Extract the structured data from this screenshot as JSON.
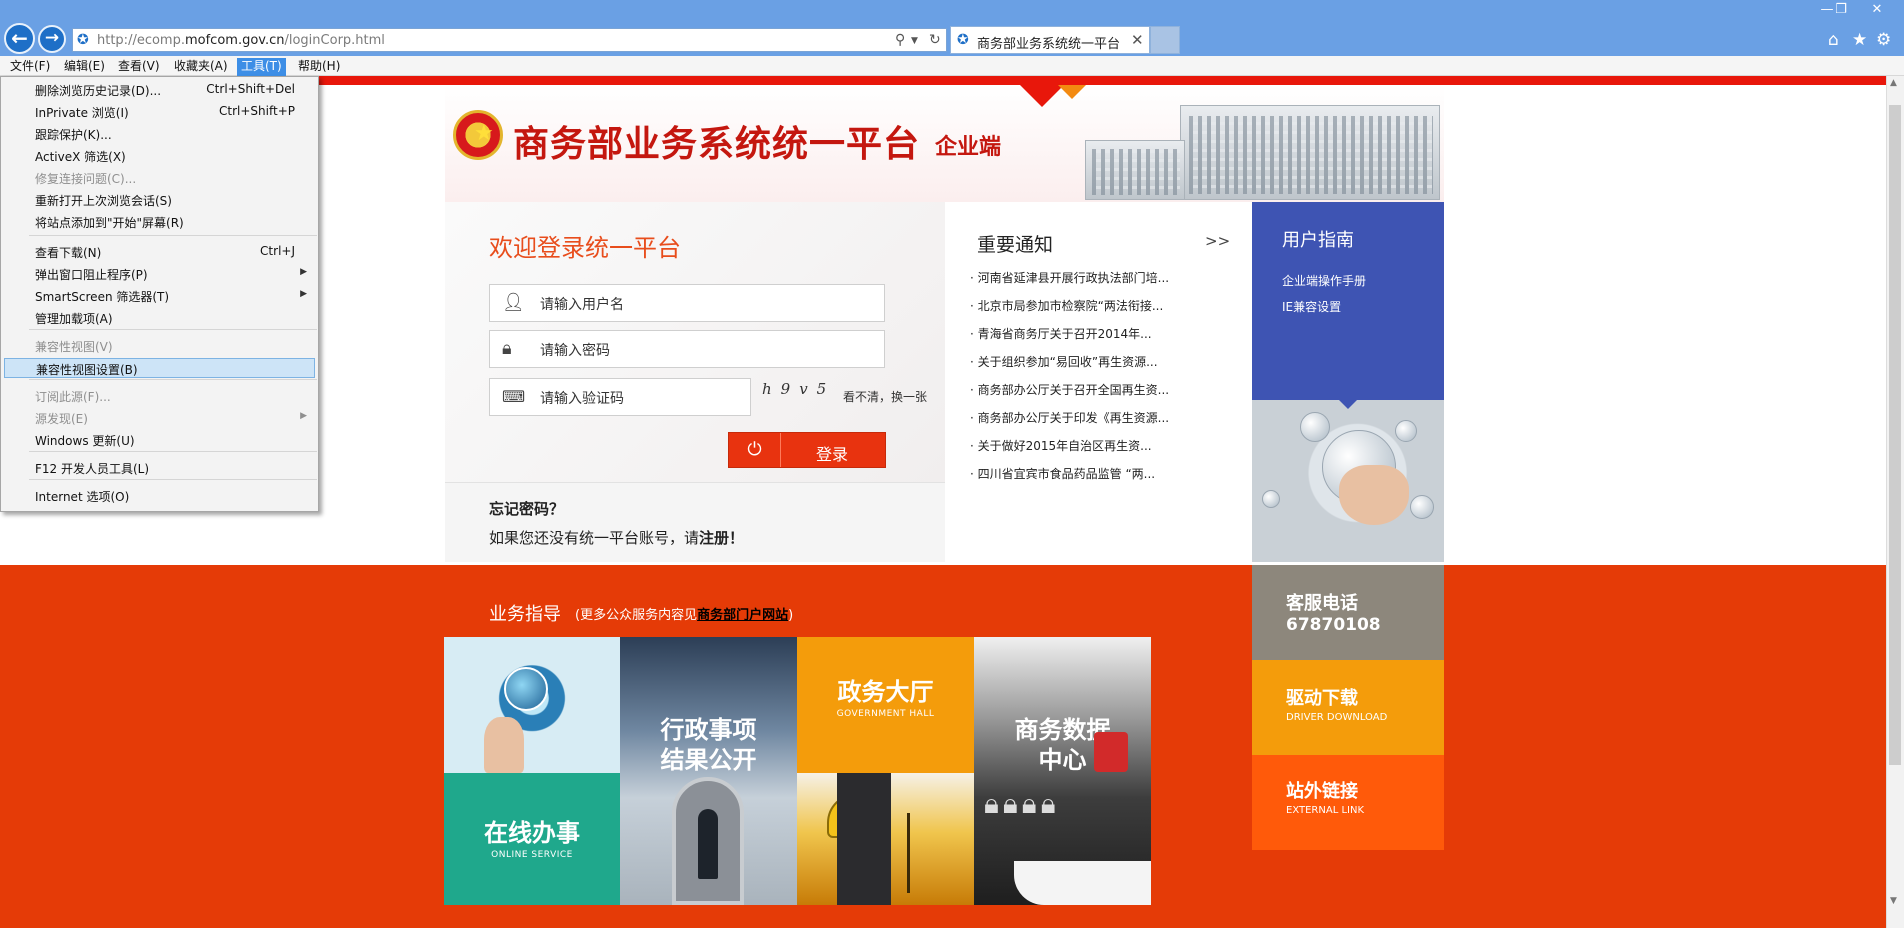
{
  "browser": {
    "url_prefix": "http://ecomp.",
    "url_domain": "mofcom.gov.cn",
    "url_path": "/loginCorp.html",
    "tab_title": "商务部业务系统统一平台",
    "menu": [
      "文件(F)",
      "编辑(E)",
      "查看(V)",
      "收藏夹(A)",
      "工具(T)",
      "帮助(H)"
    ],
    "tools_menu": [
      {
        "label": "删除浏览历史记录(D)...",
        "shortcut": "Ctrl+Shift+Del",
        "disabled": false
      },
      {
        "label": "InPrivate 浏览(I)",
        "shortcut": "Ctrl+Shift+P",
        "disabled": false
      },
      {
        "label": "跟踪保护(K)...",
        "shortcut": "",
        "disabled": false
      },
      {
        "label": "ActiveX 筛选(X)",
        "shortcut": "",
        "disabled": false
      },
      {
        "label": "修复连接问题(C)...",
        "shortcut": "",
        "disabled": true
      },
      {
        "label": "重新打开上次浏览会话(S)",
        "shortcut": "",
        "disabled": false
      },
      {
        "label": "将站点添加到\"开始\"屏幕(R)",
        "shortcut": "",
        "disabled": false
      },
      {
        "label": "查看下载(N)",
        "shortcut": "Ctrl+J",
        "disabled": false
      },
      {
        "label": "弹出窗口阻止程序(P)",
        "shortcut": "",
        "disabled": false
      },
      {
        "label": "SmartScreen 筛选器(T)",
        "shortcut": "",
        "disabled": false
      },
      {
        "label": "管理加载项(A)",
        "shortcut": "",
        "disabled": false
      },
      {
        "label": "兼容性视图(V)",
        "shortcut": "",
        "disabled": true
      },
      {
        "label": "兼容性视图设置(B)",
        "shortcut": "",
        "disabled": false
      },
      {
        "label": "订阅此源(F)...",
        "shortcut": "",
        "disabled": true
      },
      {
        "label": "源发现(E)",
        "shortcut": "",
        "disabled": true
      },
      {
        "label": "Windows 更新(U)",
        "shortcut": "",
        "disabled": false
      },
      {
        "label": "F12 开发人员工具(L)",
        "shortcut": "",
        "disabled": false
      },
      {
        "label": "Internet 选项(O)",
        "shortcut": "",
        "disabled": false
      }
    ]
  },
  "header": {
    "title": "商务部业务系统统一平台",
    "subtitle": "企业端"
  },
  "login": {
    "welcome": "欢迎登录统一平台",
    "username_placeholder": "请输入用户名",
    "password_placeholder": "请输入密码",
    "captcha_placeholder": "请输入验证码",
    "captcha_text": "h9v5",
    "captcha_refresh": "看不清，换一张",
    "submit": "登录",
    "forgot": "忘记密码？",
    "register_prefix": "如果您还没有统一平台账号，请",
    "register_link": "注册",
    "register_suffix": "！"
  },
  "notices": {
    "title": "重要通知",
    "more": ">>",
    "items": [
      "河南省延津县开展行政执法部门培...",
      "北京市局参加市检察院“两法衔接...",
      "青海省商务厅关于召开2014年...",
      "关于组织参加“易回收”再生资源...",
      "商务部办公厅关于召开全国再生资...",
      "商务部办公厅关于印发《再生资源...",
      "关于做好2015年自治区再生资...",
      "四川省宜宾市食品药品监管 “两..."
    ]
  },
  "guide": {
    "title": "用户指南",
    "links": [
      "企业端操作手册",
      "IE兼容设置"
    ]
  },
  "business": {
    "title": "业务指导",
    "sub_prefix": "(更多公众服务内容见",
    "sub_link": "商务部门户网站",
    "sub_suffix": ")",
    "tiles": {
      "online_cn": "在线办事",
      "online_en": "ONLINE SERVICE",
      "admin_cn_1": "行政事项",
      "admin_cn_2": "结果公开",
      "hall_cn": "政务大厅",
      "hall_en": "GOVERNMENT HALL",
      "data_cn_1": "商务数据",
      "data_cn_2": "中心"
    }
  },
  "side": {
    "phone_title": "客服电话",
    "phone_number": "67870108",
    "driver_cn": "驱动下载",
    "driver_en": "DRIVER DOWNLOAD",
    "link_cn": "站外链接",
    "link_en": "EXTERNAL LINK"
  },
  "colors": {
    "accent_red": "#e53b07",
    "guide_blue": "#3e54b3",
    "teal": "#1fa88c",
    "orange": "#f49c0b",
    "gray": "#8d877c"
  }
}
